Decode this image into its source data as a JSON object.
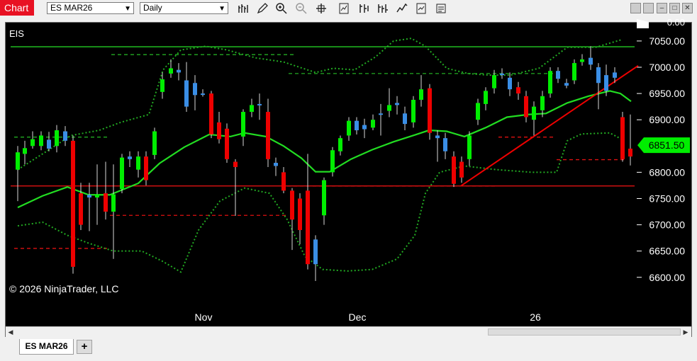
{
  "toolbar": {
    "chart_label": "Chart",
    "instrument_value": "ES MAR26",
    "interval_value": "Daily",
    "icons": [
      "bar-type-icon",
      "draw-pencil-icon",
      "zoom-in-icon",
      "zoom-out-icon",
      "crosshair-icon",
      "indicators-icon",
      "strategies-icon",
      "chart-trader-icon",
      "properties-icon",
      "templates-icon"
    ]
  },
  "window_buttons": {
    "minimize": "–",
    "maximize": "□",
    "close": "✕"
  },
  "chart": {
    "instrument_label": "EIS",
    "copyright": "© 2026 NinjaTrader, LLC",
    "price_axis_labels": [
      "0.00",
      "7050.00",
      "7000.00",
      "6950.00",
      "6900.00",
      "6851.50",
      "6800.00",
      "6750.00",
      "6700.00",
      "6650.00",
      "6600.00"
    ],
    "current_price": "6851.50",
    "x_labels": [
      "Nov",
      "Dec",
      "26"
    ],
    "colors": {
      "up": "#00ee00",
      "down": "#ee0000",
      "neutral": "#3a8ee6",
      "ma": "#22dd22",
      "band": "#22aa22",
      "trend": "#ee0000"
    }
  },
  "chart_data": {
    "type": "candlestick",
    "ylim": [
      6580,
      7080
    ],
    "candles": [
      {
        "x": 25,
        "o": 6805,
        "c": 6838,
        "h": 6850,
        "l": 6745,
        "t": "up"
      },
      {
        "x": 35,
        "o": 6835,
        "c": 6846,
        "h": 6860,
        "l": 6815,
        "t": "up"
      },
      {
        "x": 46,
        "o": 6850,
        "c": 6863,
        "h": 6878,
        "l": 6845,
        "t": "up"
      },
      {
        "x": 58,
        "o": 6850,
        "c": 6870,
        "h": 6878,
        "l": 6842,
        "t": "up"
      },
      {
        "x": 69,
        "o": 6845,
        "c": 6862,
        "h": 6877,
        "l": 6840,
        "t": "neutral"
      },
      {
        "x": 80,
        "o": 6850,
        "c": 6880,
        "h": 6890,
        "l": 6838,
        "t": "up"
      },
      {
        "x": 92,
        "o": 6860,
        "c": 6878,
        "h": 6888,
        "l": 6850,
        "t": "neutral"
      },
      {
        "x": 103,
        "o": 6860,
        "c": 6620,
        "h": 6870,
        "l": 6607,
        "t": "down"
      },
      {
        "x": 114,
        "o": 6760,
        "c": 6700,
        "h": 6780,
        "l": 6690,
        "t": "down"
      },
      {
        "x": 126,
        "o": 6752,
        "c": 6757,
        "h": 6780,
        "l": 6688,
        "t": "neutral"
      },
      {
        "x": 137,
        "o": 6752,
        "c": 6758,
        "h": 6815,
        "l": 6700,
        "t": "up"
      },
      {
        "x": 149,
        "o": 6760,
        "c": 6725,
        "h": 6820,
        "l": 6710,
        "t": "down"
      },
      {
        "x": 160,
        "o": 6725,
        "c": 6758,
        "h": 6815,
        "l": 6635,
        "t": "up"
      },
      {
        "x": 172,
        "o": 6768,
        "c": 6828,
        "h": 6835,
        "l": 6760,
        "t": "up"
      },
      {
        "x": 183,
        "o": 6825,
        "c": 6830,
        "h": 6840,
        "l": 6810,
        "t": "neutral"
      },
      {
        "x": 195,
        "o": 6805,
        "c": 6830,
        "h": 6840,
        "l": 6790,
        "t": "up"
      },
      {
        "x": 206,
        "o": 6830,
        "c": 6785,
        "h": 6840,
        "l": 6775,
        "t": "down"
      },
      {
        "x": 218,
        "o": 6833,
        "c": 6878,
        "h": 6885,
        "l": 6825,
        "t": "up"
      },
      {
        "x": 229,
        "o": 6953,
        "c": 6977,
        "h": 6990,
        "l": 6940,
        "t": "up"
      },
      {
        "x": 241,
        "o": 6988,
        "c": 6998,
        "h": 7015,
        "l": 6980,
        "t": "up"
      },
      {
        "x": 252,
        "o": 6990,
        "c": 6995,
        "h": 7008,
        "l": 6975,
        "t": "neutral"
      },
      {
        "x": 263,
        "o": 6975,
        "c": 6925,
        "h": 7010,
        "l": 6915,
        "t": "neutral"
      },
      {
        "x": 275,
        "o": 6970,
        "c": 6947,
        "h": 6985,
        "l": 6918,
        "t": "neutral"
      },
      {
        "x": 286,
        "o": 6950,
        "c": 6950,
        "h": 6958,
        "l": 6944,
        "t": "neutral"
      },
      {
        "x": 298,
        "o": 6950,
        "c": 6872,
        "h": 6955,
        "l": 6865,
        "t": "down"
      },
      {
        "x": 309,
        "o": 6895,
        "c": 6863,
        "h": 6915,
        "l": 6855,
        "t": "down"
      },
      {
        "x": 320,
        "o": 6883,
        "c": 6825,
        "h": 6893,
        "l": 6818,
        "t": "down"
      },
      {
        "x": 332,
        "o": 6820,
        "c": 6810,
        "h": 6825,
        "l": 6717,
        "t": "down"
      },
      {
        "x": 343,
        "o": 6868,
        "c": 6915,
        "h": 6920,
        "l": 6850,
        "t": "up"
      },
      {
        "x": 355,
        "o": 6915,
        "c": 6928,
        "h": 6940,
        "l": 6905,
        "t": "up"
      },
      {
        "x": 366,
        "o": 6928,
        "c": 6930,
        "h": 6950,
        "l": 6900,
        "t": "neutral"
      },
      {
        "x": 378,
        "o": 6915,
        "c": 6825,
        "h": 6940,
        "l": 6810,
        "t": "down"
      },
      {
        "x": 389,
        "o": 6818,
        "c": 6812,
        "h": 6828,
        "l": 6793,
        "t": "neutral"
      },
      {
        "x": 400,
        "o": 6800,
        "c": 6765,
        "h": 6810,
        "l": 6760,
        "t": "down"
      },
      {
        "x": 412,
        "o": 6765,
        "c": 6710,
        "h": 6770,
        "l": 6652,
        "t": "down"
      },
      {
        "x": 423,
        "o": 6750,
        "c": 6690,
        "h": 6760,
        "l": 6663,
        "t": "down"
      },
      {
        "x": 434,
        "o": 6765,
        "c": 6625,
        "h": 6835,
        "l": 6615,
        "t": "down"
      },
      {
        "x": 445,
        "o": 6672,
        "c": 6625,
        "h": 6680,
        "l": 6593,
        "t": "neutral"
      },
      {
        "x": 457,
        "o": 6718,
        "c": 6785,
        "h": 6790,
        "l": 6700,
        "t": "up"
      },
      {
        "x": 469,
        "o": 6800,
        "c": 6842,
        "h": 6848,
        "l": 6792,
        "t": "up"
      },
      {
        "x": 480,
        "o": 6840,
        "c": 6865,
        "h": 6870,
        "l": 6832,
        "t": "up"
      },
      {
        "x": 492,
        "o": 6870,
        "c": 6898,
        "h": 6905,
        "l": 6860,
        "t": "up"
      },
      {
        "x": 503,
        "o": 6898,
        "c": 6880,
        "h": 6905,
        "l": 6872,
        "t": "neutral"
      },
      {
        "x": 514,
        "o": 6882,
        "c": 6890,
        "h": 6902,
        "l": 6865,
        "t": "neutral"
      },
      {
        "x": 526,
        "o": 6885,
        "c": 6900,
        "h": 6910,
        "l": 6880,
        "t": "up"
      },
      {
        "x": 537,
        "o": 6912,
        "c": 6912,
        "h": 6930,
        "l": 6870,
        "t": "neutral"
      },
      {
        "x": 549,
        "o": 6917,
        "c": 6928,
        "h": 6960,
        "l": 6905,
        "t": "up"
      },
      {
        "x": 560,
        "o": 6928,
        "c": 6932,
        "h": 6945,
        "l": 6910,
        "t": "neutral"
      },
      {
        "x": 571,
        "o": 6912,
        "c": 6892,
        "h": 6925,
        "l": 6880,
        "t": "neutral"
      },
      {
        "x": 583,
        "o": 6895,
        "c": 6938,
        "h": 6945,
        "l": 6885,
        "t": "up"
      },
      {
        "x": 594,
        "o": 6938,
        "c": 6958,
        "h": 6985,
        "l": 6925,
        "t": "up"
      },
      {
        "x": 606,
        "o": 6960,
        "c": 6875,
        "h": 6968,
        "l": 6862,
        "t": "down"
      },
      {
        "x": 617,
        "o": 6870,
        "c": 6865,
        "h": 6880,
        "l": 6820,
        "t": "neutral"
      },
      {
        "x": 628,
        "o": 6865,
        "c": 6840,
        "h": 6875,
        "l": 6825,
        "t": "neutral"
      },
      {
        "x": 640,
        "o": 6830,
        "c": 6778,
        "h": 6840,
        "l": 6772,
        "t": "down"
      },
      {
        "x": 651,
        "o": 6820,
        "c": 6790,
        "h": 6830,
        "l": 6780,
        "t": "down"
      },
      {
        "x": 662,
        "o": 6825,
        "c": 6870,
        "h": 6878,
        "l": 6812,
        "t": "up"
      },
      {
        "x": 674,
        "o": 6900,
        "c": 6932,
        "h": 6940,
        "l": 6890,
        "t": "up"
      },
      {
        "x": 685,
        "o": 6930,
        "c": 6955,
        "h": 6962,
        "l": 6918,
        "t": "up"
      },
      {
        "x": 697,
        "o": 6960,
        "c": 6985,
        "h": 6995,
        "l": 6950,
        "t": "up"
      },
      {
        "x": 708,
        "o": 6985,
        "c": 6988,
        "h": 6998,
        "l": 6978,
        "t": "neutral"
      },
      {
        "x": 719,
        "o": 6980,
        "c": 6958,
        "h": 6990,
        "l": 6945,
        "t": "neutral"
      },
      {
        "x": 731,
        "o": 6962,
        "c": 6950,
        "h": 6972,
        "l": 6938,
        "t": "down"
      },
      {
        "x": 742,
        "o": 6945,
        "c": 6905,
        "h": 6955,
        "l": 6895,
        "t": "down"
      },
      {
        "x": 753,
        "o": 6900,
        "c": 6925,
        "h": 6935,
        "l": 6870,
        "t": "up"
      },
      {
        "x": 765,
        "o": 6918,
        "c": 6945,
        "h": 6955,
        "l": 6905,
        "t": "up"
      },
      {
        "x": 776,
        "o": 6950,
        "c": 6993,
        "h": 7000,
        "l": 6942,
        "t": "up"
      },
      {
        "x": 787,
        "o": 6993,
        "c": 6978,
        "h": 7000,
        "l": 6970,
        "t": "neutral"
      },
      {
        "x": 799,
        "o": 6970,
        "c": 6965,
        "h": 6978,
        "l": 6960,
        "t": "neutral"
      },
      {
        "x": 810,
        "o": 6975,
        "c": 7008,
        "h": 7015,
        "l": 6968,
        "t": "up"
      },
      {
        "x": 821,
        "o": 7010,
        "c": 7015,
        "h": 7025,
        "l": 7003,
        "t": "up"
      },
      {
        "x": 833,
        "o": 7018,
        "c": 7005,
        "h": 7040,
        "l": 6995,
        "t": "neutral"
      },
      {
        "x": 844,
        "o": 7000,
        "c": 6970,
        "h": 7008,
        "l": 6920,
        "t": "neutral"
      },
      {
        "x": 855,
        "o": 6985,
        "c": 6955,
        "h": 7005,
        "l": 6945,
        "t": "neutral"
      },
      {
        "x": 867,
        "o": 6980,
        "c": 6990,
        "h": 7000,
        "l": 6970,
        "t": "neutral"
      },
      {
        "x": 878,
        "o": 6905,
        "c": 6825,
        "h": 6915,
        "l": 6820,
        "t": "down"
      },
      {
        "x": 889,
        "o": 6845,
        "c": 6830,
        "h": 6910,
        "l": 6813,
        "t": "down"
      }
    ],
    "ma": [
      [
        25,
        6733
      ],
      [
        60,
        6755
      ],
      [
        95,
        6772
      ],
      [
        125,
        6757
      ],
      [
        155,
        6757
      ],
      [
        195,
        6779
      ],
      [
        225,
        6817
      ],
      [
        260,
        6848
      ],
      [
        295,
        6872
      ],
      [
        325,
        6868
      ],
      [
        345,
        6875
      ],
      [
        375,
        6868
      ],
      [
        400,
        6850
      ],
      [
        425,
        6827
      ],
      [
        445,
        6801
      ],
      [
        465,
        6801
      ],
      [
        495,
        6825
      ],
      [
        525,
        6843
      ],
      [
        555,
        6858
      ],
      [
        585,
        6871
      ],
      [
        605,
        6880
      ],
      [
        630,
        6878
      ],
      [
        655,
        6868
      ],
      [
        685,
        6885
      ],
      [
        715,
        6905
      ],
      [
        745,
        6910
      ],
      [
        770,
        6912
      ],
      [
        800,
        6932
      ],
      [
        830,
        6945
      ],
      [
        860,
        6955
      ],
      [
        875,
        6950
      ],
      [
        890,
        6935
      ]
    ],
    "upper_band": [
      [
        25,
        6805
      ],
      [
        60,
        6835
      ],
      [
        100,
        6870
      ],
      [
        140,
        6880
      ],
      [
        170,
        6895
      ],
      [
        210,
        6910
      ],
      [
        230,
        6995
      ],
      [
        255,
        7033
      ],
      [
        290,
        7040
      ],
      [
        320,
        7033
      ],
      [
        360,
        7018
      ],
      [
        400,
        7010
      ],
      [
        445,
        6990
      ],
      [
        470,
        6998
      ],
      [
        500,
        6995
      ],
      [
        530,
        7020
      ],
      [
        555,
        7050
      ],
      [
        580,
        7055
      ],
      [
        600,
        7040
      ],
      [
        630,
        6998
      ],
      [
        660,
        6988
      ],
      [
        690,
        6985
      ],
      [
        720,
        6985
      ],
      [
        760,
        6998
      ],
      [
        800,
        7038
      ],
      [
        840,
        7038
      ],
      [
        878,
        7053
      ]
    ],
    "lower_band": [
      [
        25,
        6698
      ],
      [
        60,
        6705
      ],
      [
        95,
        6680
      ],
      [
        125,
        6665
      ],
      [
        160,
        6650
      ],
      [
        200,
        6650
      ],
      [
        230,
        6630
      ],
      [
        255,
        6610
      ],
      [
        280,
        6690
      ],
      [
        310,
        6745
      ],
      [
        345,
        6770
      ],
      [
        380,
        6760
      ],
      [
        405,
        6710
      ],
      [
        430,
        6640
      ],
      [
        455,
        6615
      ],
      [
        490,
        6612
      ],
      [
        525,
        6615
      ],
      [
        560,
        6635
      ],
      [
        585,
        6680
      ],
      [
        600,
        6760
      ],
      [
        620,
        6800
      ],
      [
        655,
        6812
      ],
      [
        700,
        6805
      ],
      [
        750,
        6800
      ],
      [
        785,
        6800
      ],
      [
        800,
        6860
      ],
      [
        820,
        6873
      ],
      [
        860,
        6875
      ],
      [
        878,
        6862
      ]
    ],
    "horizontal_lines": [
      {
        "y": 7039,
        "x1": 15,
        "x2": 895,
        "color": "#22cc22",
        "dash": false
      },
      {
        "y": 6774,
        "x1": 15,
        "x2": 895,
        "color": "#dd1111",
        "dash": false
      },
      {
        "y": 6867,
        "x1": 20,
        "x2": 152,
        "color": "#22aa22",
        "dash": true
      },
      {
        "y": 7024,
        "x1": 157,
        "x2": 415,
        "color": "#22aa22",
        "dash": true
      },
      {
        "y": 6988,
        "x1": 407,
        "x2": 780,
        "color": "#22aa22",
        "dash": true
      },
      {
        "y": 6718,
        "x1": 155,
        "x2": 405,
        "color": "#dd1111",
        "dash": true
      },
      {
        "y": 6655,
        "x1": 20,
        "x2": 152,
        "color": "#dd1111",
        "dash": true
      },
      {
        "y": 6774,
        "x1": 405,
        "x2": 700,
        "color": "#dd1111",
        "dash": true
      },
      {
        "y": 6867,
        "x1": 703,
        "x2": 780,
        "color": "#dd1111",
        "dash": true
      },
      {
        "y": 6824,
        "x1": 785,
        "x2": 880,
        "color": "#dd1111",
        "dash": true
      }
    ],
    "trend_lines": [
      [
        [
          650,
          6774
        ],
        [
          900,
          7003
        ]
      ]
    ]
  }
}
